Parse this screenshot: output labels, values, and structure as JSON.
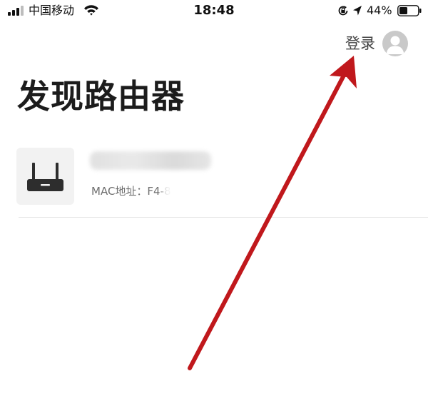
{
  "status_bar": {
    "carrier": "中国移动",
    "time": "18:48",
    "battery_percent": "44%",
    "icons": [
      "signal-icon",
      "wifi-icon",
      "rotation-lock-icon",
      "location-arrow-icon",
      "battery-icon"
    ],
    "battery_level": 0.44
  },
  "header": {
    "login_label": "登录",
    "avatar_icon": "user-avatar-icon"
  },
  "page": {
    "title": "发现路由器"
  },
  "devices": [
    {
      "icon": "router-icon",
      "mac_label": "MAC地址：F4-8"
    }
  ],
  "annotation": {
    "color": "#c0181c"
  }
}
